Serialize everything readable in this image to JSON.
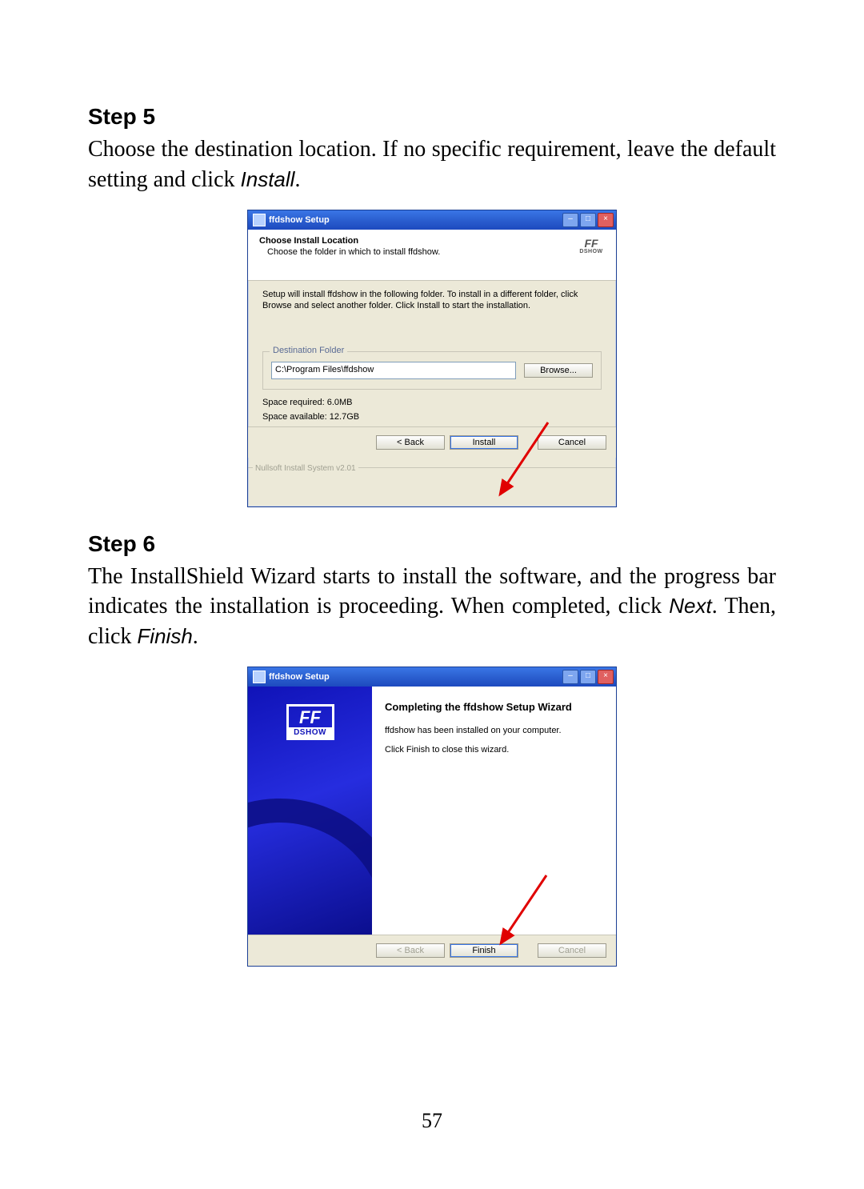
{
  "doc": {
    "step5": {
      "heading": "Step 5",
      "text_before": "Choose the destination location.  If no specific requirement, leave the default setting and click ",
      "action_word": "Install",
      "text_after": "."
    },
    "step6": {
      "heading": "Step 6",
      "text_a": "The InstallShield Wizard starts to install the software, and the progress bar indicates the installation is proceeding.  When completed, click ",
      "word_next": "Next",
      "text_b": ".  Then, click ",
      "word_finish": "Finish",
      "text_c": "."
    },
    "page_number": "57"
  },
  "win1": {
    "title": "ffdshow Setup",
    "header_bold": "Choose Install Location",
    "header_sub": "Choose the folder in which to install ffdshow.",
    "logo_main": "FF",
    "logo_sub": "DSHOW",
    "instruction": "Setup will install ffdshow in the following folder. To install in a different folder, click Browse and select another folder. Click Install to start the installation.",
    "fieldset_legend": "Destination Folder",
    "path": "C:\\Program Files\\ffdshow",
    "browse": "Browse...",
    "space_req": "Space required: 6.0MB",
    "space_avail": "Space available: 12.7GB",
    "sysline": "Nullsoft Install System v2.01",
    "btn_back": "< Back",
    "btn_install": "Install",
    "btn_cancel": "Cancel"
  },
  "win2": {
    "title": "ffdshow Setup",
    "logo_main": "FF",
    "logo_sub": "DSHOW",
    "completing_title": "Completing the ffdshow Setup Wizard",
    "line1": "ffdshow has been installed on your computer.",
    "line2": "Click Finish to close this wizard.",
    "btn_back": "< Back",
    "btn_finish": "Finish",
    "btn_cancel": "Cancel"
  }
}
